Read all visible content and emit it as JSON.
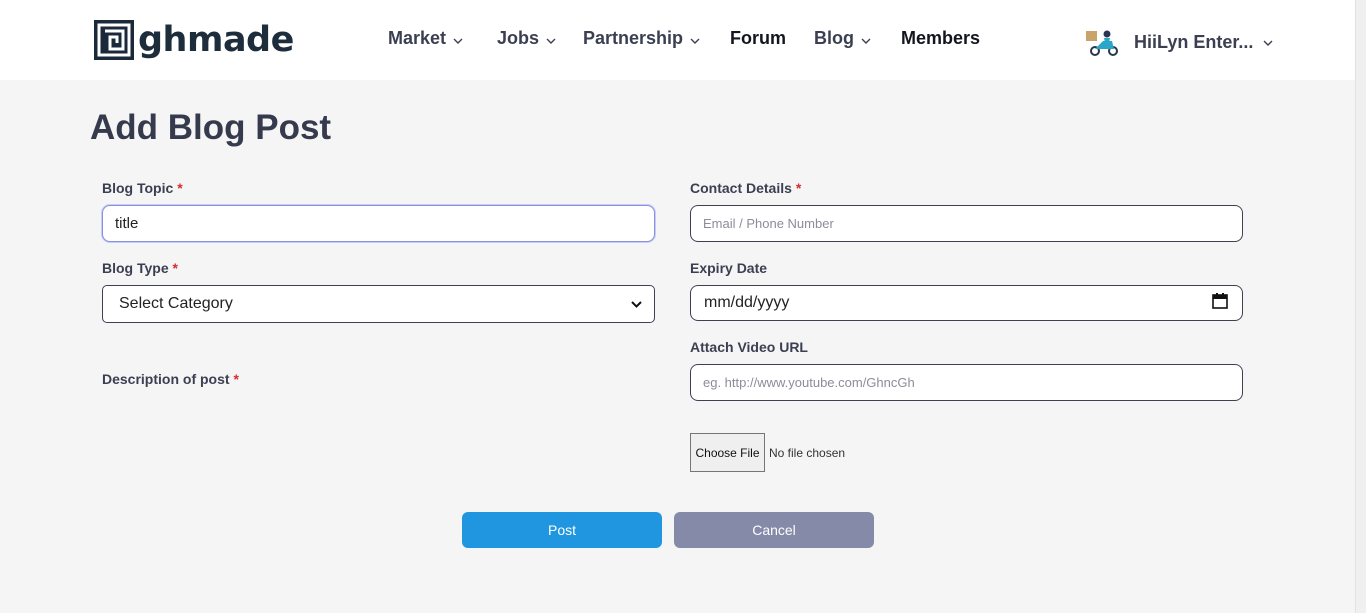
{
  "brand": {
    "name": "ghmade"
  },
  "nav": {
    "items": [
      {
        "label": "Market",
        "has_dropdown": true
      },
      {
        "label": "Jobs",
        "has_dropdown": true
      },
      {
        "label": "Partnership",
        "has_dropdown": true
      },
      {
        "label": "Forum",
        "has_dropdown": false
      },
      {
        "label": "Blog",
        "has_dropdown": true
      },
      {
        "label": "Members",
        "has_dropdown": false
      }
    ]
  },
  "user": {
    "name": "HiiLyn Enter..."
  },
  "page": {
    "title": "Add Blog Post"
  },
  "form": {
    "blog_topic": {
      "label": "Blog Topic",
      "required_mark": "*",
      "value": "title"
    },
    "contact_details": {
      "label": "Contact Details",
      "required_mark": "*",
      "placeholder": "Email / Phone Number"
    },
    "blog_type": {
      "label": "Blog Type",
      "required_mark": "*",
      "selected": "Select Category"
    },
    "expiry_date": {
      "label": "Expiry Date",
      "value": "mm/dd/yyyy"
    },
    "video_url": {
      "label": "Attach Video URL",
      "placeholder": "eg. http://www.youtube.com/GhncGh"
    },
    "description": {
      "label": "Description of post",
      "required_mark": "*"
    },
    "file": {
      "button_label": "Choose File",
      "status": "No file chosen"
    },
    "actions": {
      "post_label": "Post",
      "cancel_label": "Cancel"
    }
  },
  "colors": {
    "primary": "#2196e0",
    "secondary": "#848aa7",
    "required": "#d32f2f",
    "brand_dark": "#1e2d3c"
  }
}
